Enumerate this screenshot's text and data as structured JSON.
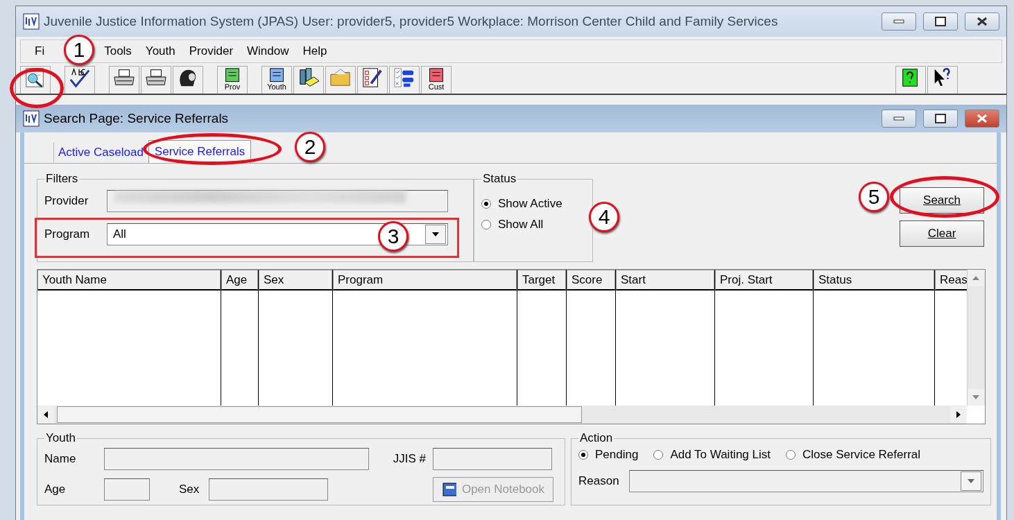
{
  "window": {
    "title": "Juvenile Justice Information System (JPAS)  User: provider5, provider5  Workplace: Morrison Center Child and Family Services"
  },
  "menu": [
    "Fi",
    "Tools",
    "Youth",
    "Provider",
    "Window",
    "Help"
  ],
  "toolbar": {
    "left_groups": [
      [
        {
          "kind": "search"
        }
      ],
      [
        {
          "kind": "spellcheck"
        }
      ],
      [
        {
          "kind": "printer"
        },
        {
          "kind": "printer"
        },
        {
          "kind": "head"
        }
      ],
      [
        {
          "kind": "notebook",
          "color": "#5ccc5c",
          "caption": "Prov"
        }
      ],
      [
        {
          "kind": "notebook",
          "color": "#7fb0f0",
          "caption": "Youth"
        },
        {
          "kind": "books"
        },
        {
          "kind": "folder"
        },
        {
          "kind": "checklist"
        },
        {
          "kind": "list"
        },
        {
          "kind": "notebook",
          "color": "#f06070",
          "caption": "Cust"
        }
      ]
    ],
    "right_groups": [
      [
        {
          "kind": "helpbook"
        },
        {
          "kind": "pointerhelp"
        }
      ]
    ]
  },
  "child_window": {
    "title": "Search   Page: Service Referrals"
  },
  "tabs": [
    {
      "label": "Active Caseload",
      "selected": false
    },
    {
      "label": "Service Referrals",
      "selected": true
    }
  ],
  "filters": {
    "title": "Filters",
    "provider_label": "Provider",
    "program_label": "Program",
    "program_value": "All"
  },
  "status": {
    "title": "Status",
    "options": [
      {
        "label": "Show Active",
        "selected": true
      },
      {
        "label": "Show All",
        "selected": false
      }
    ]
  },
  "buttons": [
    "Search",
    "Clear"
  ],
  "table": {
    "columns": [
      "Youth Name",
      "Age",
      "Sex",
      "Program",
      "Target",
      "Score",
      "Start",
      "Proj. Start",
      "Status",
      "Reas"
    ]
  },
  "youth": {
    "title": "Youth",
    "name_label": "Name",
    "jjis_label": "JJIS #",
    "age_label": "Age",
    "sex_label": "Sex",
    "notebook_button": "Open Notebook"
  },
  "action": {
    "title": "Action",
    "options": [
      {
        "label": "Pending",
        "selected": true
      },
      {
        "label": "Add To Waiting List",
        "selected": false
      },
      {
        "label": "Close Service Referral",
        "selected": false
      }
    ],
    "reason_label": "Reason"
  },
  "callouts": [
    {
      "number": "1",
      "kind": "ellipse"
    },
    {
      "number": "2",
      "kind": "ellipse"
    },
    {
      "number": "3",
      "kind": "rectangle"
    },
    {
      "number": "4"
    },
    {
      "number": "5",
      "kind": "ellipse"
    }
  ]
}
